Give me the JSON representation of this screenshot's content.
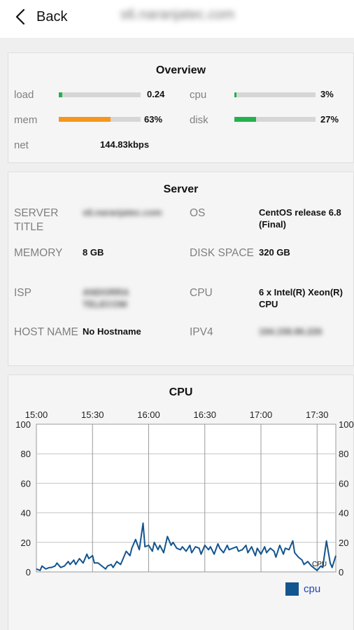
{
  "header": {
    "back_label": "Back",
    "host_title": "s6.naranjatec.com"
  },
  "overview": {
    "title": "Overview",
    "metrics": [
      {
        "label": "load",
        "value_text": "0.24",
        "fill_fraction": 0.04,
        "color": "#22b24c"
      },
      {
        "label": "cpu",
        "value_text": "3%",
        "fill_fraction": 0.03,
        "color": "#22b24c"
      },
      {
        "label": "mem",
        "value_text": "63%",
        "fill_fraction": 0.63,
        "color": "#f7961d"
      },
      {
        "label": "disk",
        "value_text": "27%",
        "fill_fraction": 0.27,
        "color": "#22b24c"
      }
    ],
    "net": {
      "label": "net",
      "value_text": "144.83kbps"
    }
  },
  "server": {
    "title": "Server",
    "fields": [
      {
        "label": "SERVER TITLE",
        "value": "s6.naranjatec.com",
        "blurred": true
      },
      {
        "label": "OS",
        "value": "CentOS release 6.8 (Final)",
        "blurred": false
      },
      {
        "label": "MEMORY",
        "value": "8 GB",
        "blurred": false
      },
      {
        "label": "DISK SPACE",
        "value": "320 GB",
        "blurred": false
      },
      {
        "label": "ISP",
        "value": "ANDORRA TELECOM",
        "blurred": true
      },
      {
        "label": "CPU",
        "value": "6 x Intel(R) Xeon(R) CPU",
        "blurred": false
      },
      {
        "label": "HOST NAME",
        "value": "No Hostname",
        "blurred": false
      },
      {
        "label": "IPV4",
        "value": "194.158.86.226",
        "blurred": true
      }
    ]
  },
  "cpu_chart": {
    "title": "CPU",
    "legend_label": "cpu",
    "series_color": "#13558f",
    "chart_data": {
      "type": "line",
      "title": "CPU",
      "x_ticks": [
        "15:00",
        "15:30",
        "16:00",
        "16:30",
        "17:00",
        "17:30"
      ],
      "ylim": [
        0,
        100
      ],
      "y_ticks": [
        0,
        20,
        40,
        60,
        80,
        100
      ],
      "grid": true,
      "legend": "bottom-right",
      "annotation": "CPU",
      "series": [
        {
          "name": "cpu",
          "x_minutes_from_1500": [
            0,
            2,
            3,
            5,
            7,
            8,
            10,
            11,
            13,
            15,
            17,
            18,
            20,
            21,
            23,
            25,
            27,
            28,
            30,
            31,
            33,
            35,
            37,
            38,
            40,
            41,
            43,
            45,
            46,
            48,
            50,
            51,
            53,
            55,
            57,
            58,
            60,
            62,
            63,
            65,
            66,
            68,
            70,
            72,
            73,
            75,
            77,
            78,
            80,
            82,
            83,
            85,
            87,
            88,
            90,
            92,
            93,
            95,
            97,
            98,
            100,
            102,
            103,
            105,
            107,
            108,
            110,
            112,
            113,
            115,
            117,
            118,
            120,
            122,
            123,
            125,
            127,
            128,
            130,
            132,
            133,
            135,
            137,
            138,
            140,
            142,
            143,
            145,
            147,
            148,
            150,
            152,
            153,
            155,
            157,
            158,
            160
          ],
          "y": [
            2,
            1,
            4,
            2,
            3,
            3,
            4,
            6,
            3,
            4,
            7,
            5,
            8,
            5,
            9,
            6,
            12,
            9,
            11,
            6,
            6,
            4,
            2,
            4,
            5,
            3,
            7,
            5,
            8,
            14,
            11,
            16,
            22,
            15,
            33,
            17,
            18,
            14,
            20,
            15,
            18,
            13,
            24,
            18,
            20,
            16,
            15,
            17,
            14,
            18,
            13,
            17,
            16,
            12,
            18,
            15,
            17,
            12,
            19,
            16,
            13,
            18,
            15,
            16,
            17,
            14,
            15,
            18,
            13,
            17,
            11,
            16,
            12,
            17,
            13,
            16,
            14,
            10,
            18,
            12,
            16,
            15,
            21,
            13,
            10,
            8,
            5,
            7,
            4,
            3,
            1,
            4,
            3,
            21,
            6,
            3,
            11
          ]
        }
      ]
    }
  }
}
